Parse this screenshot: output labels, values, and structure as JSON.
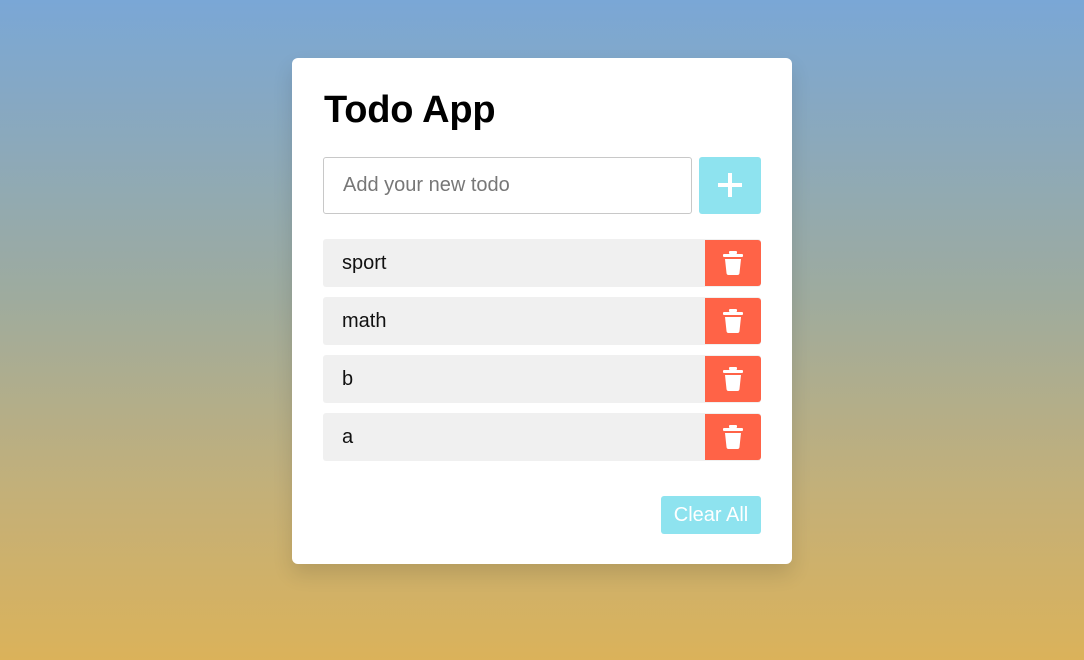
{
  "app": {
    "title": "Todo App"
  },
  "input": {
    "placeholder": "Add your new todo",
    "value": ""
  },
  "add_button": {
    "icon": "plus-icon"
  },
  "todos": [
    {
      "text": "sport"
    },
    {
      "text": "math"
    },
    {
      "text": "b"
    },
    {
      "text": "a"
    }
  ],
  "delete_button": {
    "icon": "trash-icon"
  },
  "clear_all": {
    "label": "Clear All"
  },
  "colors": {
    "accent": "#8ee3ef",
    "delete": "#ff6347",
    "item_background": "#f0f0f0",
    "gradient_top": "#7aa7d6",
    "gradient_bottom": "#dbb25a"
  }
}
